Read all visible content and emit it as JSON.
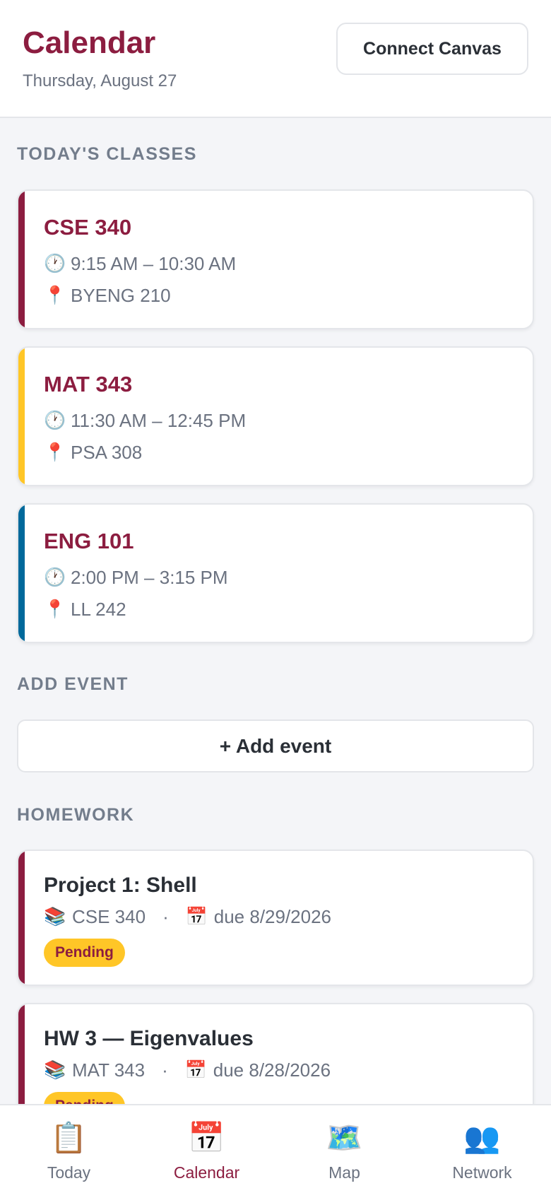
{
  "header": {
    "title": "Calendar",
    "date": "Thursday, August 27",
    "connect_label": "Connect Canvas"
  },
  "sections": {
    "classes_label": "TODAY'S CLASSES",
    "add_label": "ADD EVENT",
    "homework_label": "HOMEWORK"
  },
  "classes": [
    {
      "name": "CSE 340",
      "time": "9:15 AM – 10:30 AM",
      "location": "BYENG 210",
      "accent": "#8c1d40"
    },
    {
      "name": "MAT 343",
      "time": "11:30 AM – 12:45 PM",
      "location": "PSA 308",
      "accent": "#ffc627"
    },
    {
      "name": "ENG 101",
      "time": "2:00 PM – 3:15 PM",
      "location": "LL 242",
      "accent": "#00699b"
    }
  ],
  "add_event_label": "+ Add event",
  "homework": [
    {
      "title": "Project 1: Shell",
      "course": "CSE 340",
      "due": "due 8/29/2026",
      "status": "Pending"
    },
    {
      "title": "HW 3 — Eigenvalues",
      "course": "MAT 343",
      "due": "due 8/28/2026",
      "status": "Pending"
    }
  ],
  "icons": {
    "clock": "🕐",
    "pin": "📍",
    "books": "📚",
    "calendar": "📅",
    "separator": "·"
  },
  "tabs": [
    {
      "label": "Today",
      "icon": "📋"
    },
    {
      "label": "Calendar",
      "icon": "📅"
    },
    {
      "label": "Map",
      "icon": "🗺️"
    },
    {
      "label": "Network",
      "icon": "👥"
    }
  ],
  "active_tab": "Calendar",
  "colors": {
    "brand": "#8c1d40",
    "gold": "#ffc627",
    "blue": "#00699b"
  }
}
